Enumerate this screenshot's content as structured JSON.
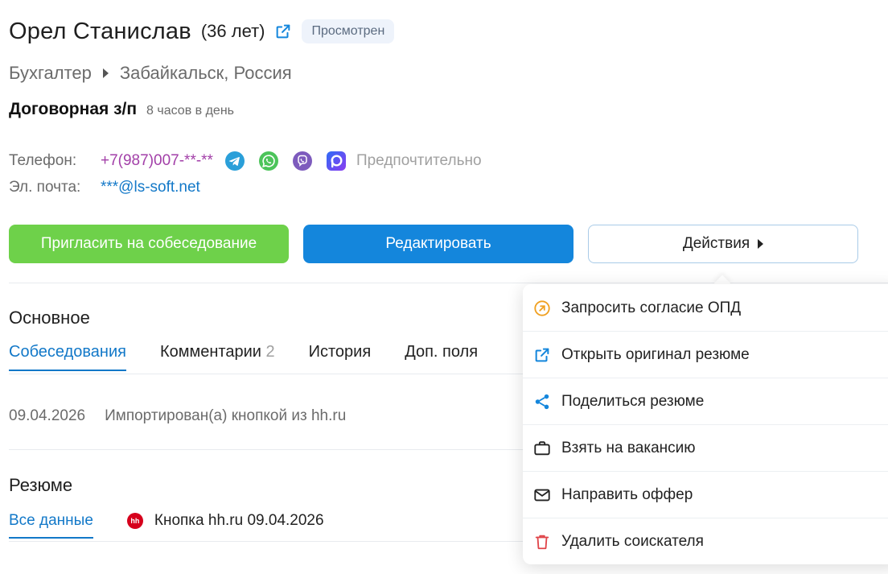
{
  "header": {
    "name": "Орел Станислав",
    "age": "(36 лет)",
    "status_badge": "Просмотрен"
  },
  "position": {
    "title": "Бухгалтер",
    "location": "Забайкальск, Россия"
  },
  "salary": {
    "label": "Договорная з/п",
    "hours": "8 часов в день"
  },
  "contacts": {
    "phone_label": "Телефон:",
    "phone_value": "+7(987)007-**-**",
    "preferred_text": "Предпочтительно",
    "email_label": "Эл. почта:",
    "email_value": "***@ls-soft.net",
    "messengers": [
      "telegram-icon",
      "whatsapp-icon",
      "viber-icon",
      "max-messenger-icon"
    ]
  },
  "buttons": {
    "invite": "Пригласить на собеседование",
    "edit": "Редактировать",
    "actions": "Действия"
  },
  "main_section": {
    "title": "Основное",
    "tabs": [
      {
        "label": "Собеседования",
        "count": ""
      },
      {
        "label": "Комментарии",
        "count": "2"
      },
      {
        "label": "История",
        "count": ""
      },
      {
        "label": "Доп. поля",
        "count": ""
      }
    ],
    "event": {
      "date": "09.04.2026",
      "text": "Импортирован(а) кнопкой из hh.ru"
    }
  },
  "resume_section": {
    "title": "Резюме",
    "all_data_tab": "Все данные",
    "hh_logo_text": "hh",
    "source_tab": "Кнопка hh.ru 09.04.2026"
  },
  "actions_menu": {
    "items": [
      {
        "label": "Запросить согласие ОПД",
        "icon": "consent-arrow-icon"
      },
      {
        "label": "Открыть оригинал резюме",
        "icon": "external-link-icon"
      },
      {
        "label": "Поделиться резюме",
        "icon": "share-icon"
      },
      {
        "label": "Взять на вакансию",
        "icon": "briefcase-icon"
      },
      {
        "label": "Направить оффер",
        "icon": "envelope-icon"
      },
      {
        "label": "Удалить соискателя",
        "icon": "trash-icon"
      }
    ]
  },
  "colors": {
    "accent_blue": "#1486dc",
    "invite_green": "#6ed14a",
    "phone_purple": "#a23fa8",
    "link_blue": "#1278c8",
    "delete_red": "#e0454a",
    "consent_orange": "#f0a020"
  }
}
